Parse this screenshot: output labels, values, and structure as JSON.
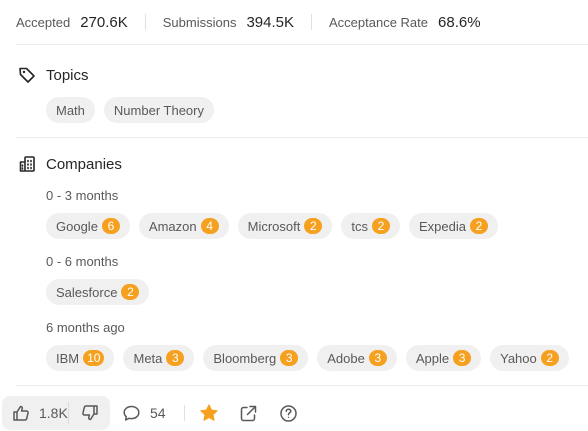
{
  "stats": [
    {
      "label": "Accepted",
      "value": "270.6K"
    },
    {
      "label": "Submissions",
      "value": "394.5K"
    },
    {
      "label": "Acceptance Rate",
      "value": "68.6%"
    }
  ],
  "topics": {
    "title": "Topics",
    "icon": "tag-icon",
    "tags": [
      "Math",
      "Number Theory"
    ]
  },
  "companies": {
    "title": "Companies",
    "icon": "building-icon",
    "badge_color": "#f5a11f",
    "groups": [
      {
        "period": "0 - 3 months",
        "items": [
          {
            "name": "Google",
            "count": "6"
          },
          {
            "name": "Amazon",
            "count": "4"
          },
          {
            "name": "Microsoft",
            "count": "2"
          },
          {
            "name": "tcs",
            "count": "2"
          },
          {
            "name": "Expedia",
            "count": "2"
          }
        ]
      },
      {
        "period": "0 - 6 months",
        "items": [
          {
            "name": "Salesforce",
            "count": "2"
          }
        ]
      },
      {
        "period": "6 months ago",
        "items": [
          {
            "name": "IBM",
            "count": "10"
          },
          {
            "name": "Meta",
            "count": "3"
          },
          {
            "name": "Bloomberg",
            "count": "3"
          },
          {
            "name": "Adobe",
            "count": "3"
          },
          {
            "name": "Apple",
            "count": "3"
          },
          {
            "name": "Yahoo",
            "count": "2"
          }
        ]
      }
    ]
  },
  "footer": {
    "upvotes": "1.8K",
    "comments": "54",
    "star_color": "#f5a11f",
    "icons": [
      "thumbs-up-icon",
      "thumbs-down-icon",
      "comment-icon",
      "star-icon",
      "share-icon",
      "help-icon"
    ]
  }
}
